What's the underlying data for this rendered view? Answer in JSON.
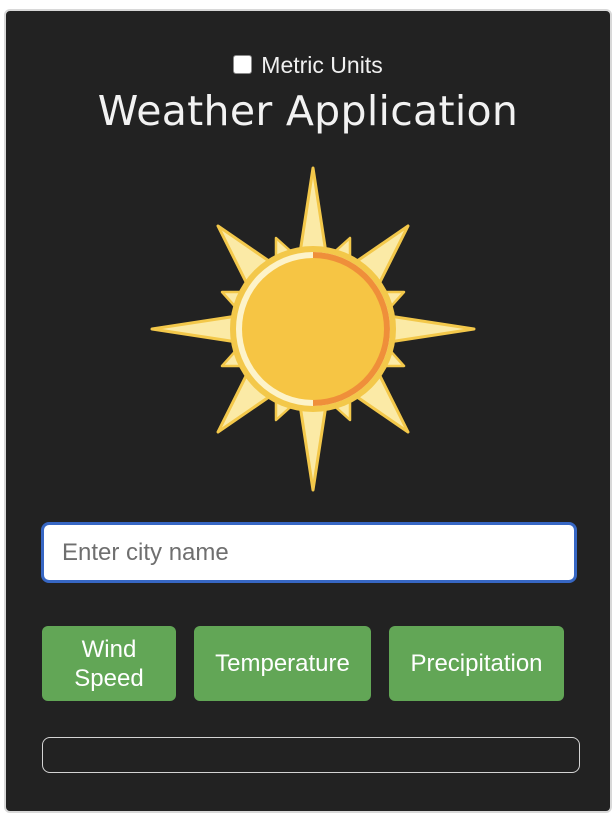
{
  "settings": {
    "metric_label": "Metric Units",
    "metric_checked": false
  },
  "header": {
    "title": "Weather Application"
  },
  "illustration": {
    "icon": "sun-icon",
    "colors": {
      "ray_outline": "#f3c84a",
      "ray_fill": "#fbeaa6",
      "sun_core": "#f6c544",
      "sun_ring": "#fdf3c9",
      "sun_shade": "#ef8f3a"
    }
  },
  "search": {
    "placeholder": "Enter city name",
    "value": ""
  },
  "actions": {
    "wind_label_line1": "Wind",
    "wind_label_line2": "Speed",
    "temperature_label": "Temperature",
    "precipitation_label": "Precipitation"
  },
  "result": {
    "text": ""
  },
  "theme": {
    "background": "#222222",
    "button_color": "#62a656",
    "input_focus": "#3767c4"
  }
}
